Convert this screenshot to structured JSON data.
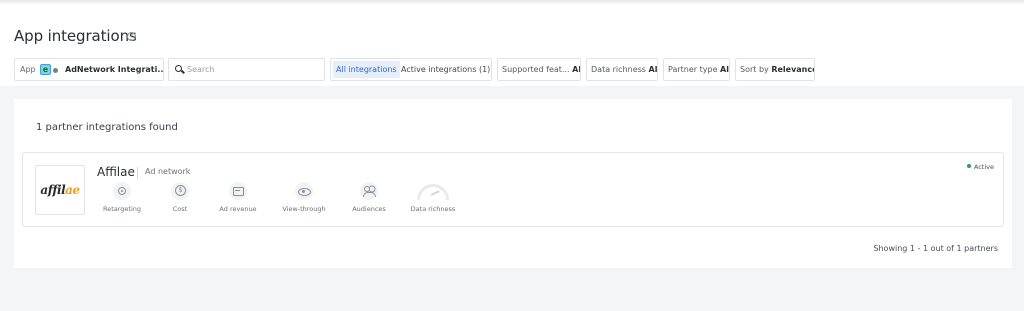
{
  "page": {
    "title": "App integrations"
  },
  "filters": {
    "app": {
      "label": "App",
      "value": "AdNetwork Integrati..."
    },
    "search": {
      "placeholder": "Search",
      "value": ""
    },
    "tabs": {
      "all": "All integrations",
      "active": "Active integrations (1)"
    },
    "supported_features": {
      "label": "Supported feat...",
      "value": "All"
    },
    "data_richness": {
      "label": "Data richness",
      "value": "All"
    },
    "partner_type": {
      "label": "Partner type",
      "value": "All"
    },
    "sort": {
      "label": "Sort by",
      "value": "Relevance"
    }
  },
  "results": {
    "found_text": "1 partner integrations found",
    "showing_text": "Showing 1 - 1 out of 1 partners"
  },
  "partner": {
    "logo_text_a": "affil",
    "logo_text_b": "ae",
    "name": "Affilae",
    "type": "Ad network",
    "status": "Active",
    "status_color": "#2e9e5b",
    "features": [
      {
        "label": "Retargeting",
        "icon": "retargeting-icon"
      },
      {
        "label": "Cost",
        "icon": "dollar-icon"
      },
      {
        "label": "Ad revenue",
        "icon": "ad-revenue-icon"
      },
      {
        "label": "View-through",
        "icon": "eye-icon"
      },
      {
        "label": "Audiences",
        "icon": "users-icon"
      },
      {
        "label": "Data richness",
        "icon": "gauge-icon"
      }
    ]
  },
  "colors": {
    "accent": "#2f6bd1",
    "accent_bg": "#e6eef9"
  }
}
